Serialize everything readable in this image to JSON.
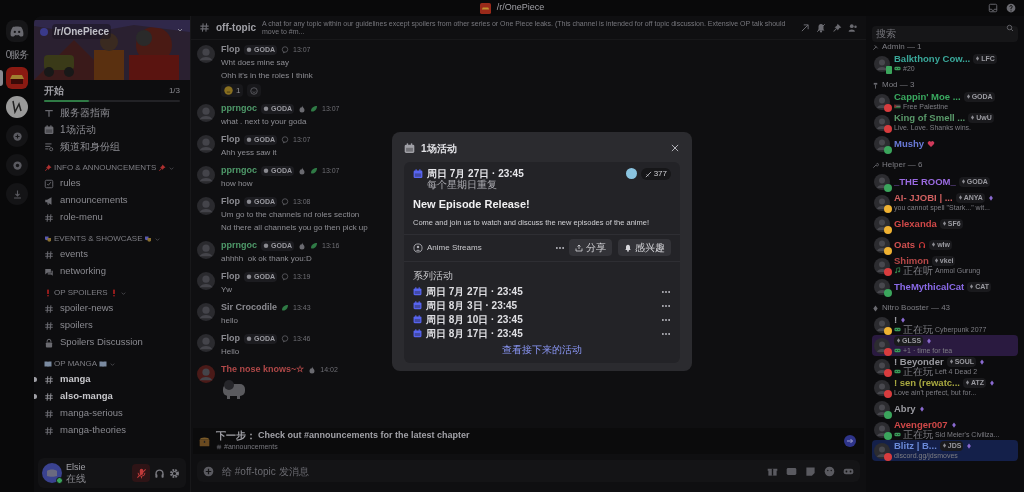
{
  "title_bar": {
    "title": "/r/OnePiece"
  },
  "server_rail": {
    "label": "0服务",
    "servers": [
      {
        "kind": "straw-hat",
        "selected": true
      },
      {
        "kind": "sketch",
        "selected": false
      }
    ]
  },
  "server": {
    "name": "/r/OnePiece",
    "progress": {
      "label": "开始",
      "count": "1/3",
      "level": 0.33
    },
    "shortcuts": [
      {
        "kind": "guide",
        "label": "服务器指南"
      },
      {
        "kind": "calendar",
        "label": "1场活动"
      },
      {
        "kind": "roles",
        "label": "频道和身份组"
      }
    ],
    "categories": [
      {
        "name": "INFO & ANNOUNCEMENTS",
        "kind": "pin",
        "channels": [
          {
            "kind": "rules",
            "name": "rules",
            "unread": false
          },
          {
            "kind": "announcement",
            "name": "announcements",
            "unread": false
          },
          {
            "kind": "text",
            "name": "role-menu",
            "unread": false
          }
        ]
      },
      {
        "name": "EVENTS & SHOWCASE",
        "kind": "mask",
        "channels": [
          {
            "kind": "text",
            "name": "events",
            "unread": false
          },
          {
            "kind": "forum",
            "name": "networking",
            "unread": false
          }
        ]
      },
      {
        "name": "OP SPOILERS",
        "kind": "exclaim",
        "channels": [
          {
            "kind": "text",
            "name": "spoiler-news",
            "unread": false
          },
          {
            "kind": "text",
            "name": "spoilers",
            "unread": false
          },
          {
            "kind": "lock",
            "name": "Spoilers Discussion",
            "unread": false
          }
        ]
      },
      {
        "name": "OP MANGA",
        "kind": "book",
        "channels": [
          {
            "kind": "text",
            "name": "manga",
            "unread": true
          },
          {
            "kind": "text",
            "name": "also-manga",
            "unread": true
          },
          {
            "kind": "text",
            "name": "manga-serious",
            "unread": false
          },
          {
            "kind": "text",
            "name": "manga-theories",
            "unread": false
          }
        ]
      }
    ]
  },
  "user": {
    "name": "Elsie",
    "status": "在线",
    "muted": true
  },
  "channel": {
    "name": "off-topic",
    "topic": "A chat for any topic within our guidelines except spoilers from other series or One Piece leaks. (This channel is intended for off topic discussion. Extensive OP talk should move to #m..."
  },
  "messages": [
    {
      "author": "Flop",
      "color": "#8a8a90",
      "tag": "GODA",
      "badges": [
        {
          "kind": "speech"
        }
      ],
      "time": "13:07",
      "lines": [
        "Wht does mine say",
        "Ohh it's in the roles I think"
      ],
      "reactions": [
        {
          "count": "1"
        }
      ]
    },
    {
      "author": "pprngoc",
      "color": "#4f9a6a",
      "tag": "GODA",
      "badges": [
        {
          "kind": "flame"
        },
        {
          "kind": "leaf"
        }
      ],
      "time": "13:07",
      "lines": [
        "what . next to your goda"
      ]
    },
    {
      "author": "Flop",
      "color": "#8a8a90",
      "tag": "GODA",
      "badges": [
        {
          "kind": "speech"
        }
      ],
      "time": "13:07",
      "lines": [
        "Ahh yess saw it"
      ]
    },
    {
      "author": "pprngoc",
      "color": "#4f9a6a",
      "tag": "GODA",
      "badges": [
        {
          "kind": "flame"
        },
        {
          "kind": "leaf"
        }
      ],
      "time": "13:07",
      "lines": [
        "how how"
      ]
    },
    {
      "author": "Flop",
      "color": "#8a8a90",
      "tag": "GODA",
      "badges": [
        {
          "kind": "speech"
        }
      ],
      "time": "13:08",
      "lines": [
        "Um go to the channels nd roles section",
        "Nd there all channels you go then pick up"
      ]
    },
    {
      "author": "pprngoc",
      "color": "#4f9a6a",
      "tag": "GODA",
      "badges": [
        {
          "kind": "flame"
        },
        {
          "kind": "leaf"
        }
      ],
      "time": "13:16",
      "lines": [
        "ahhhh  ok ok thank you:D"
      ]
    },
    {
      "author": "Flop",
      "color": "#8a8a90",
      "tag": "GODA",
      "badges": [
        {
          "kind": "speech"
        }
      ],
      "time": "13:19",
      "lines": [
        "Yw"
      ]
    },
    {
      "author": "Sir Crocodile",
      "color": "#8a8a90",
      "badges": [
        {
          "kind": "leaf"
        }
      ],
      "time": "13:43",
      "lines": [
        "hello"
      ]
    },
    {
      "author": "Flop",
      "color": "#8a8a90",
      "tag": "GODA",
      "badges": [
        {
          "kind": "speech"
        }
      ],
      "time": "13:46",
      "lines": [
        "Hello"
      ]
    },
    {
      "author": "The nose knows~☆",
      "color": "#b04848",
      "badges": [
        {
          "kind": "flame"
        }
      ],
      "time": "14:02",
      "sticker": true
    }
  ],
  "next_step": {
    "label": "下一步：",
    "text": "Check out #announcements for the latest chapter",
    "channel": "#announcements"
  },
  "composer": {
    "placeholder": "给 #off-topic 发消息"
  },
  "members": {
    "search": {
      "placeholder": "搜索"
    },
    "groups": [
      {
        "name": "Admin — 1",
        "kind": "tools",
        "members": [
          {
            "name": "Balkthony Cow...",
            "color": "#3aa89a",
            "status": {
              "kind": "mobile",
              "color": "#3ba55c"
            },
            "tag": "LFC",
            "activity": {
              "kind": "game",
              "text": "#20"
            }
          }
        ]
      },
      {
        "name": "Mod — 3",
        "kind": "hammer",
        "members": [
          {
            "name": "Cappin' Moe ...",
            "color": "#3aaa60",
            "status": {
              "kind": "dot",
              "color": "#d83c3e"
            },
            "tag": "GODA",
            "activity": {
              "kind": "flag",
              "text": "Free Palestine"
            }
          },
          {
            "name": "King of Smell ...",
            "color": "#5a9a6a",
            "status": {
              "kind": "dot",
              "color": "#d83c3e"
            },
            "tag": "UwU",
            "activity": {
              "text": "Live. Love. Shanks wins."
            }
          },
          {
            "name": "Mushy",
            "color": "#6a7ad8",
            "status": {
              "kind": "dot",
              "color": "#3ba55c"
            },
            "heart": true
          }
        ]
      },
      {
        "name": "Helper — 6",
        "kind": "wrench",
        "members": [
          {
            "name": "_THE ROOM_",
            "color": "#9a6ae0",
            "status": {
              "kind": "dot",
              "color": "#3ba55c"
            },
            "tag": "GODA"
          },
          {
            "name": "AI- JJOBI | ...",
            "color": "#d06060",
            "status": {
              "kind": "dot",
              "color": "#f0b232"
            },
            "tag": "ANYA",
            "booster": true,
            "activity": {
              "text": "you cannot spell \"Stark...\" wit..."
            }
          },
          {
            "name": "Glexanda",
            "color": "#d04848",
            "status": {
              "kind": "dot",
              "color": "#f0b232"
            },
            "tag": "SF6"
          },
          {
            "name": "Oats",
            "color": "#d05050",
            "status": {
              "kind": "dot",
              "color": "#f0b232"
            },
            "tag": "wlw",
            "headphones": true
          },
          {
            "name": "Shimon",
            "color": "#b84848",
            "status": {
              "kind": "dot",
              "color": "#d83c3e"
            },
            "tag": "vkei",
            "activity": {
              "kind": "music",
              "verb": "正在听",
              "text": "Anmol Gurung"
            }
          },
          {
            "name": "TheMythicalCat",
            "color": "#8a6ae8",
            "status": {
              "kind": "dot",
              "color": "#3ba55c"
            },
            "tag": "CAT"
          }
        ]
      },
      {
        "name": "Nitro Booster — 43",
        "kind": "gem",
        "members": [
          {
            "name": "!",
            "color": "#9a9aa0",
            "status": {
              "kind": "dot",
              "color": "#f0b232"
            },
            "booster": true,
            "activity": {
              "kind": "game",
              "verb": "正在玩",
              "text": "Cyberpunk 2077"
            }
          },
          {
            "status": {
              "kind": "dot",
              "color": "#d83c3e"
            },
            "tag": "GLSS",
            "booster": true,
            "backdrop": {
              "color": "#2a1a40"
            },
            "activity": {
              "kind": "game",
              "text": "+1 · time for tea"
            }
          },
          {
            "name": "! Beyonder",
            "color": "#9a9aa0",
            "status": {
              "kind": "dot",
              "color": "#d83c3e"
            },
            "tag": "SOUL",
            "booster": true,
            "activity": {
              "kind": "game",
              "verb": "正在玩",
              "text": "Left 4 Dead 2"
            }
          },
          {
            "name": "! sen (rewatc...",
            "color": "#a8a840",
            "status": {
              "kind": "dot",
              "color": "#d83c3e"
            },
            "tag": "ATZ",
            "booster": true,
            "activity": {
              "text": "Love ain't perfect, but for..."
            }
          },
          {
            "name": "Abry",
            "color": "#9a9aa0",
            "status": {
              "kind": "dot",
              "color": "#3ba55c"
            },
            "booster": true
          },
          {
            "name": "Avenger007",
            "color": "#d04848",
            "status": {
              "kind": "dot",
              "color": "#3ba55c"
            },
            "booster": true,
            "activity": {
              "kind": "game",
              "verb": "正在玩",
              "text": "Sid Meier's Civiliza..."
            }
          },
          {
            "name": "Blitz | B...",
            "color": "#6a8ad8",
            "status": {
              "kind": "dot",
              "color": "#d83c3e"
            },
            "tag": "JDS",
            "booster": true,
            "backdrop": {
              "color": "#14204a"
            },
            "activity": {
              "text": "discord.gg/jdsmoves"
            }
          }
        ]
      }
    ]
  },
  "modal": {
    "title": "1场活动",
    "event": {
      "date": "周日 7月 27日 · 23:45",
      "repeat": "每个星期日重复",
      "interested": "377",
      "title": "New Episode Release!",
      "description": "Come and join us to watch and discuss the new episodes of the anime!",
      "location": "Anime Streams",
      "share": "分享",
      "interest": "感兴趣"
    },
    "series_label": "系列活动",
    "series": [
      "周日 7月 27日 · 23:45",
      "周日 8月 3日 · 23:45",
      "周日 8月 10日 · 23:45",
      "周日 8月 17日 · 23:45"
    ],
    "more": "查看接下来的活动"
  }
}
